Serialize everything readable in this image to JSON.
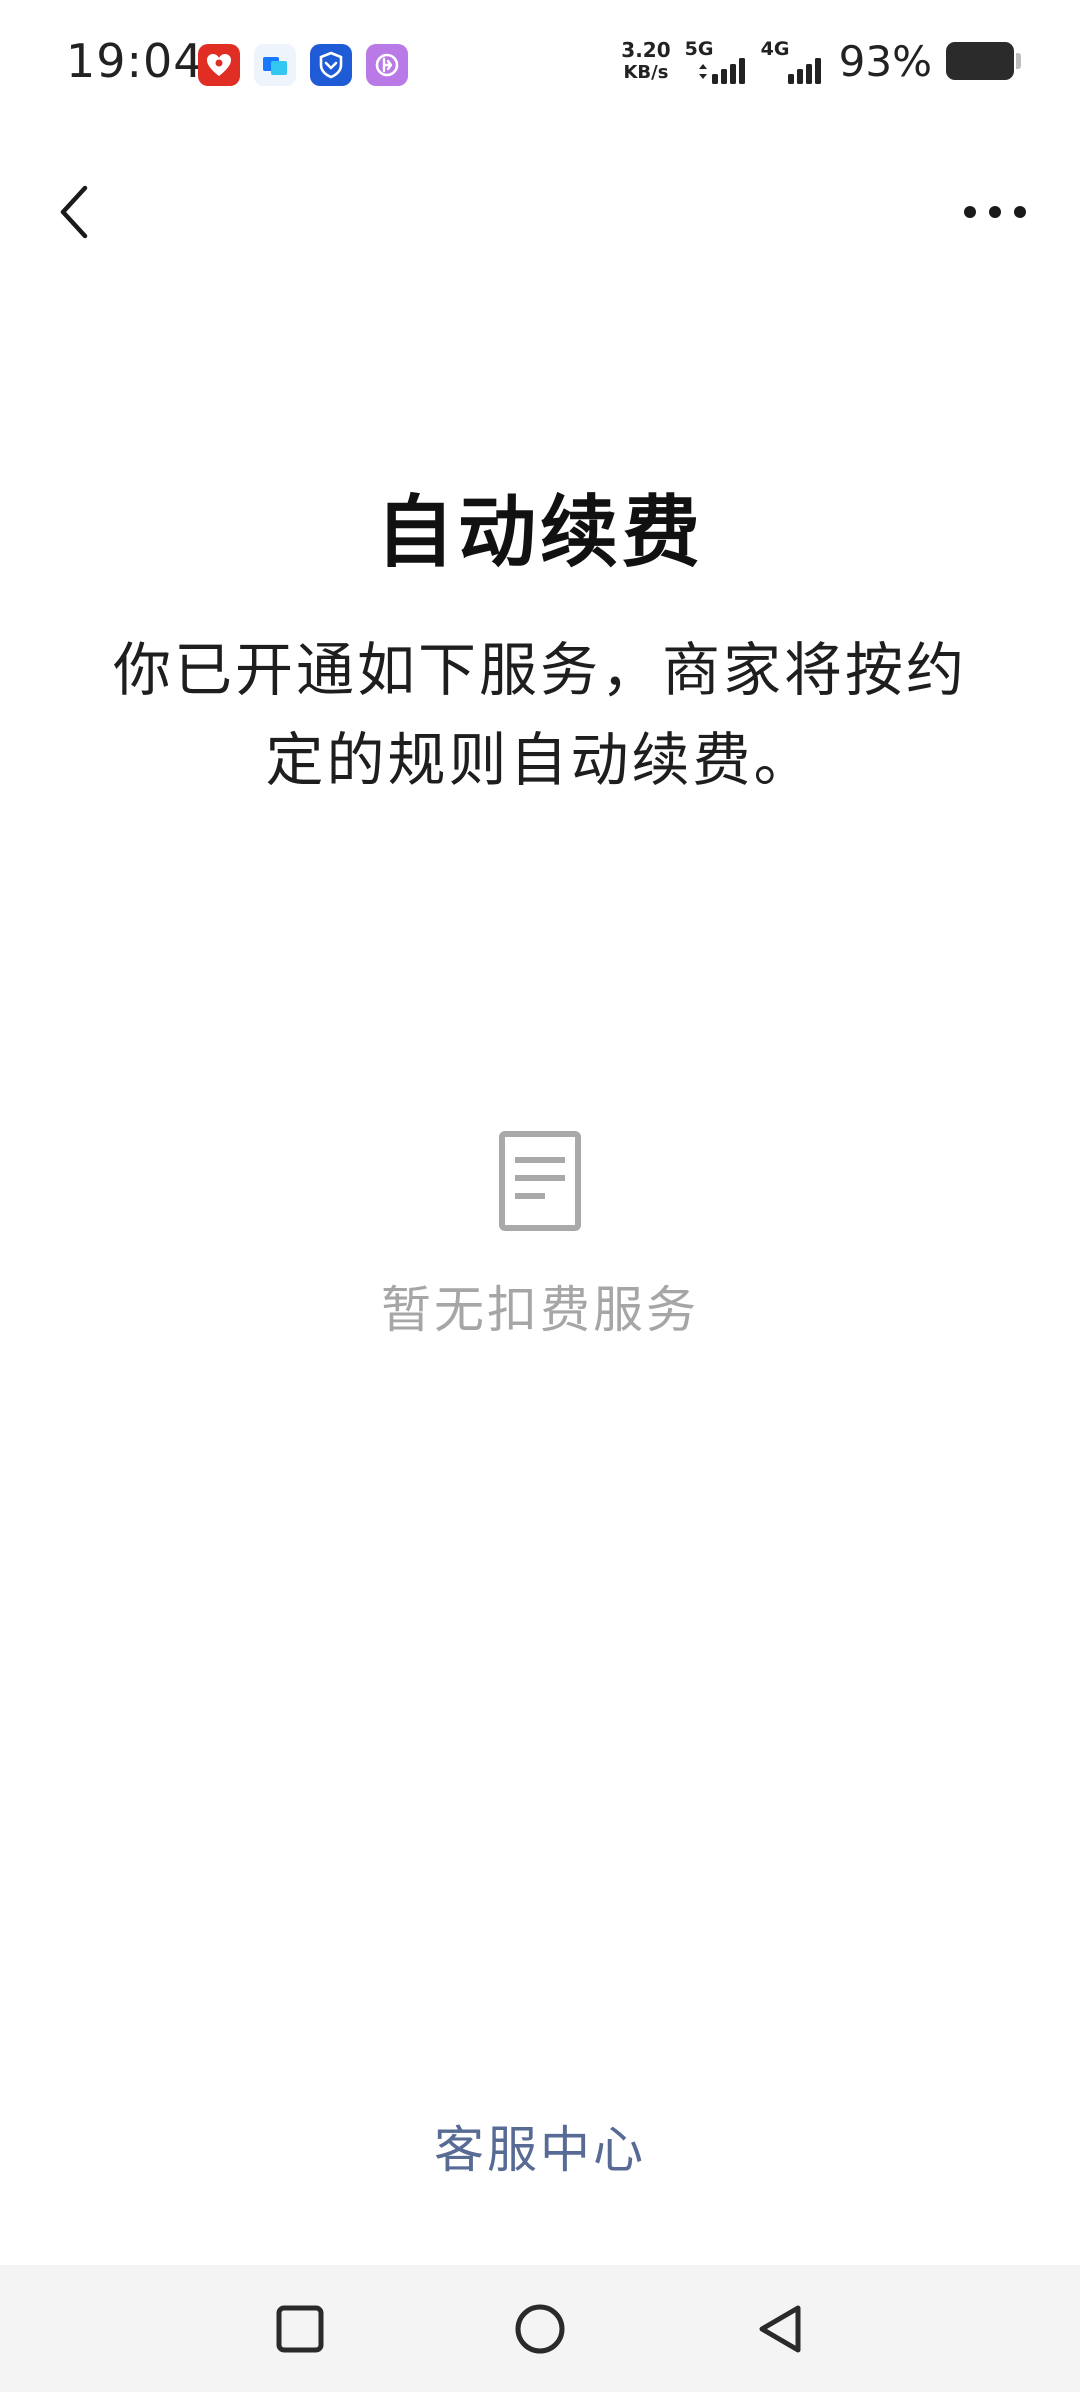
{
  "status_bar": {
    "time": "19:04",
    "net_speed_value": "3.20",
    "net_speed_unit": "KB/s",
    "signal_1_label": "5G",
    "signal_2_label": "4G",
    "battery_percent": "93%",
    "notification_icons": [
      "pinduoduo-app-icon",
      "alipay-app-icon",
      "security-shield-app-icon",
      "purple-app-icon"
    ]
  },
  "nav": {
    "back_icon": "chevron-left-icon",
    "more_icon": "more-dots-icon"
  },
  "main": {
    "title": "自动续费",
    "description": "你已开通如下服务，商家将按约定的规则自动续费。",
    "empty_icon": "document-icon",
    "empty_text": "暂无扣费服务"
  },
  "footer": {
    "service_link": "客服中心",
    "link_color": "#576b95"
  },
  "system_nav": {
    "recent_icon": "square-recent-icon",
    "home_icon": "circle-home-icon",
    "back_icon": "triangle-back-icon"
  }
}
